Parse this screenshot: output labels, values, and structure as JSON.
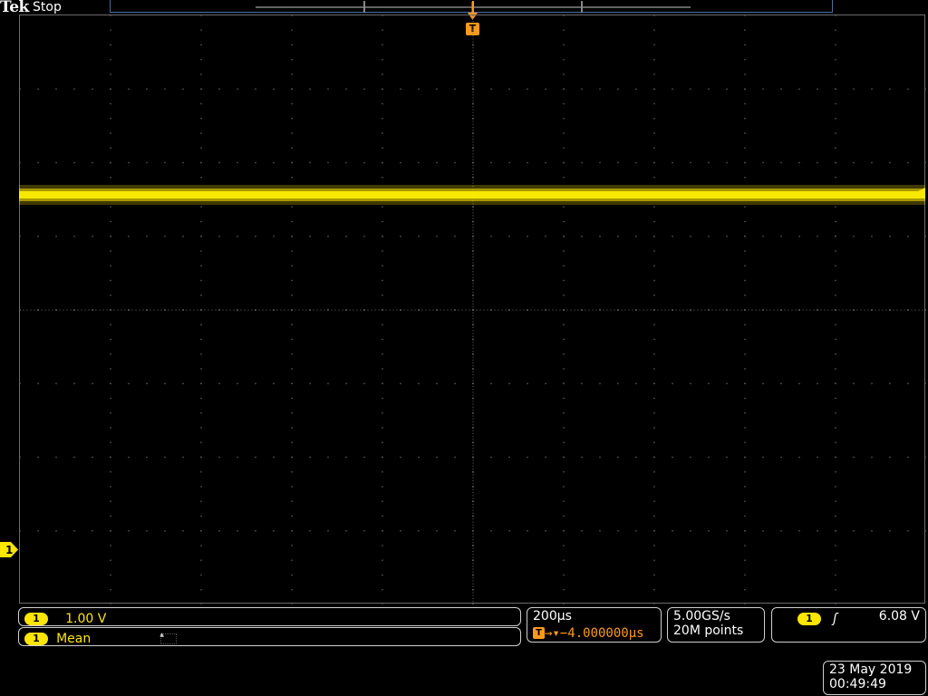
{
  "header": {
    "brand": "Tek",
    "run_state": "Stop"
  },
  "markers": {
    "ch1_ground": "1",
    "trigger_position": "T"
  },
  "vertical": {
    "channel": "1",
    "scale": "1.00 V"
  },
  "measurement": {
    "channel": "1",
    "name": "Mean"
  },
  "horizontal": {
    "scale": "200µs",
    "trigger_icon": "T",
    "delay": "→▾−4.000000µs"
  },
  "acquisition": {
    "sample_rate": "5.00GS/s",
    "record_length": "20M points"
  },
  "trigger": {
    "channel": "1",
    "slope_icon": "rising-edge-icon",
    "slope_glyph": "ʃ",
    "level": "6.08 V"
  },
  "timestamp": {
    "date": "23 May 2019",
    "time": "00:49:49"
  },
  "colors": {
    "ch1": "#ffe600",
    "trigger": "#ff9a1a",
    "graticule": "#6c6c6c",
    "background": "#000000"
  }
}
